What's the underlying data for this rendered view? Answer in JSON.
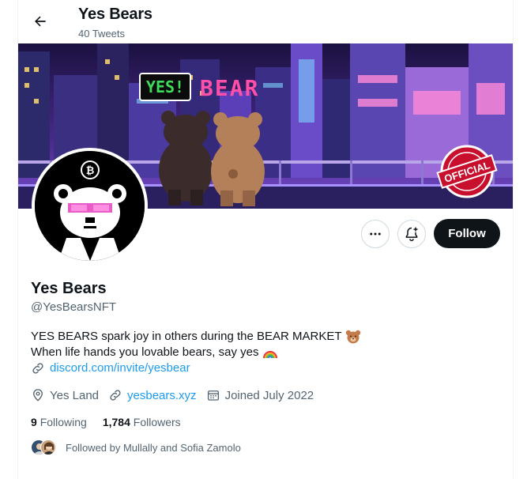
{
  "header": {
    "title": "Yes Bears",
    "tweet_count": "40 Tweets"
  },
  "banner": {
    "sign_yes": "YES!",
    "sign_bear": "BEAR",
    "stamp": "OFFICIAL"
  },
  "actions": {
    "follow_label": "Follow"
  },
  "profile": {
    "name": "Yes Bears",
    "handle": "@YesBearsNFT",
    "bio_line1": "YES BEARS spark joy in others during the BEAR MARKET",
    "bio_line2": "When life hands you lovable bears, say yes",
    "bio_link": "discord.com/invite/yesbear",
    "location": "Yes Land",
    "website": "yesbears.xyz",
    "joined": "Joined July 2022"
  },
  "stats": {
    "following_count": "9",
    "following_label": "Following",
    "followers_count": "1,784",
    "followers_label": "Followers"
  },
  "followed_by": {
    "text": "Followed by Mullally and Sofia Zamolo"
  },
  "colors": {
    "accent": "#1d9bf0",
    "text_primary": "#0f1419",
    "text_secondary": "#536471",
    "follow_button": "#0f1419",
    "sign_green": "#3ddc5a",
    "sign_pink": "#ff4fa8",
    "stamp_red": "#c8102e"
  }
}
